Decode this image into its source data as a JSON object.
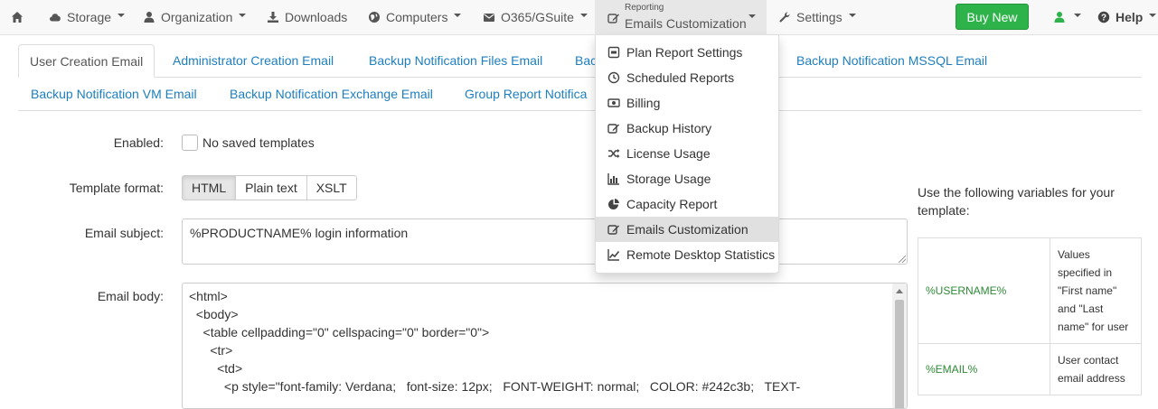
{
  "navbar": {
    "storage_label": "Storage",
    "organization_label": "Organization",
    "downloads_label": "Downloads",
    "computers_label": "Computers",
    "o365_label": "O365/GSuite",
    "reporting_small": "Reporting",
    "reporting_current": "Emails Customization",
    "settings_label": "Settings",
    "buy_label": "Buy New",
    "help_label": "Help",
    "buy_color": "#2eb34a"
  },
  "tabs": {
    "row1": [
      "User Creation Email",
      "Administrator Creation Email",
      "Backup Notification Files Email",
      "Bac",
      "Backup Notification MSSQL Email"
    ],
    "row2": [
      "Backup Notification VM Email",
      "Backup Notification Exchange Email",
      "Group Report Notifica"
    ]
  },
  "form": {
    "enabled_label": "Enabled:",
    "no_templates_text": "No saved templates",
    "format_label": "Template format:",
    "formats": [
      "HTML",
      "Plain text",
      "XSLT"
    ],
    "selected_format": "HTML",
    "subject_label": "Email subject:",
    "subject_value": "%PRODUCTNAME% login information",
    "body_label": "Email body:",
    "body_lines": [
      "<html>",
      "  <body>",
      "    <table cellpadding=\"0\" cellspacing=\"0\" border=\"0\">",
      "      <tr>",
      "        <td>",
      "          <p style=\"font-family: Verdana;   font-size: 12px;   FONT-WEIGHT: normal;   COLOR: #242c3b;   TEXT-"
    ]
  },
  "variables": {
    "intro": "Use the following variables for your template:",
    "rows": [
      {
        "key": "%USERNAME%",
        "desc": "Values specified in \"First name\" and \"Last name\" for user"
      },
      {
        "key": "%EMAIL%",
        "desc": "User contact email address"
      }
    ],
    "key_color": "#2e8a36"
  },
  "reporting_menu": {
    "items": [
      {
        "label": "Plan Report Settings",
        "icon": "form-icon"
      },
      {
        "label": "Scheduled Reports",
        "icon": "clock-icon"
      },
      {
        "label": "Billing",
        "icon": "money-icon"
      },
      {
        "label": "Backup History",
        "icon": "edit-icon"
      },
      {
        "label": "License Usage",
        "icon": "shuffle-icon"
      },
      {
        "label": "Storage Usage",
        "icon": "bar-chart-icon"
      },
      {
        "label": "Capacity Report",
        "icon": "pie-chart-icon"
      },
      {
        "label": "Emails Customization",
        "icon": "edit-icon"
      },
      {
        "label": "Remote Desktop Statistics",
        "icon": "line-chart-icon"
      }
    ],
    "selected": "Emails Customization"
  },
  "colors": {
    "link": "#1d7fbf",
    "navbar_bg": "#f8f8f8"
  }
}
